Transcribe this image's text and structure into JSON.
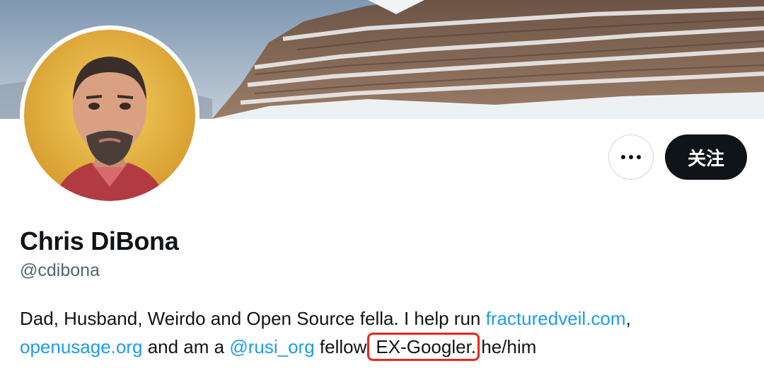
{
  "profile": {
    "name": "Chris DiBona",
    "handle": "@cdibona",
    "follow_label": "关注",
    "more_icon": "more-horizontal-icon",
    "bio": {
      "seg1": "Dad, Husband, Weirdo  and Open Source fella. I help run ",
      "link1": "fracturedveil.com",
      "seg2": ",",
      "link2": "openusage.org",
      "seg3": " and am a ",
      "link3": "@rusi_org",
      "seg4": " fellow.",
      "highlight": " EX-Googler.",
      "seg5": " he/him"
    }
  },
  "colors": {
    "link": "#1d9bf0",
    "follow_bg": "#0f1419",
    "highlight_box": "#e8271c",
    "handle": "#536471"
  }
}
